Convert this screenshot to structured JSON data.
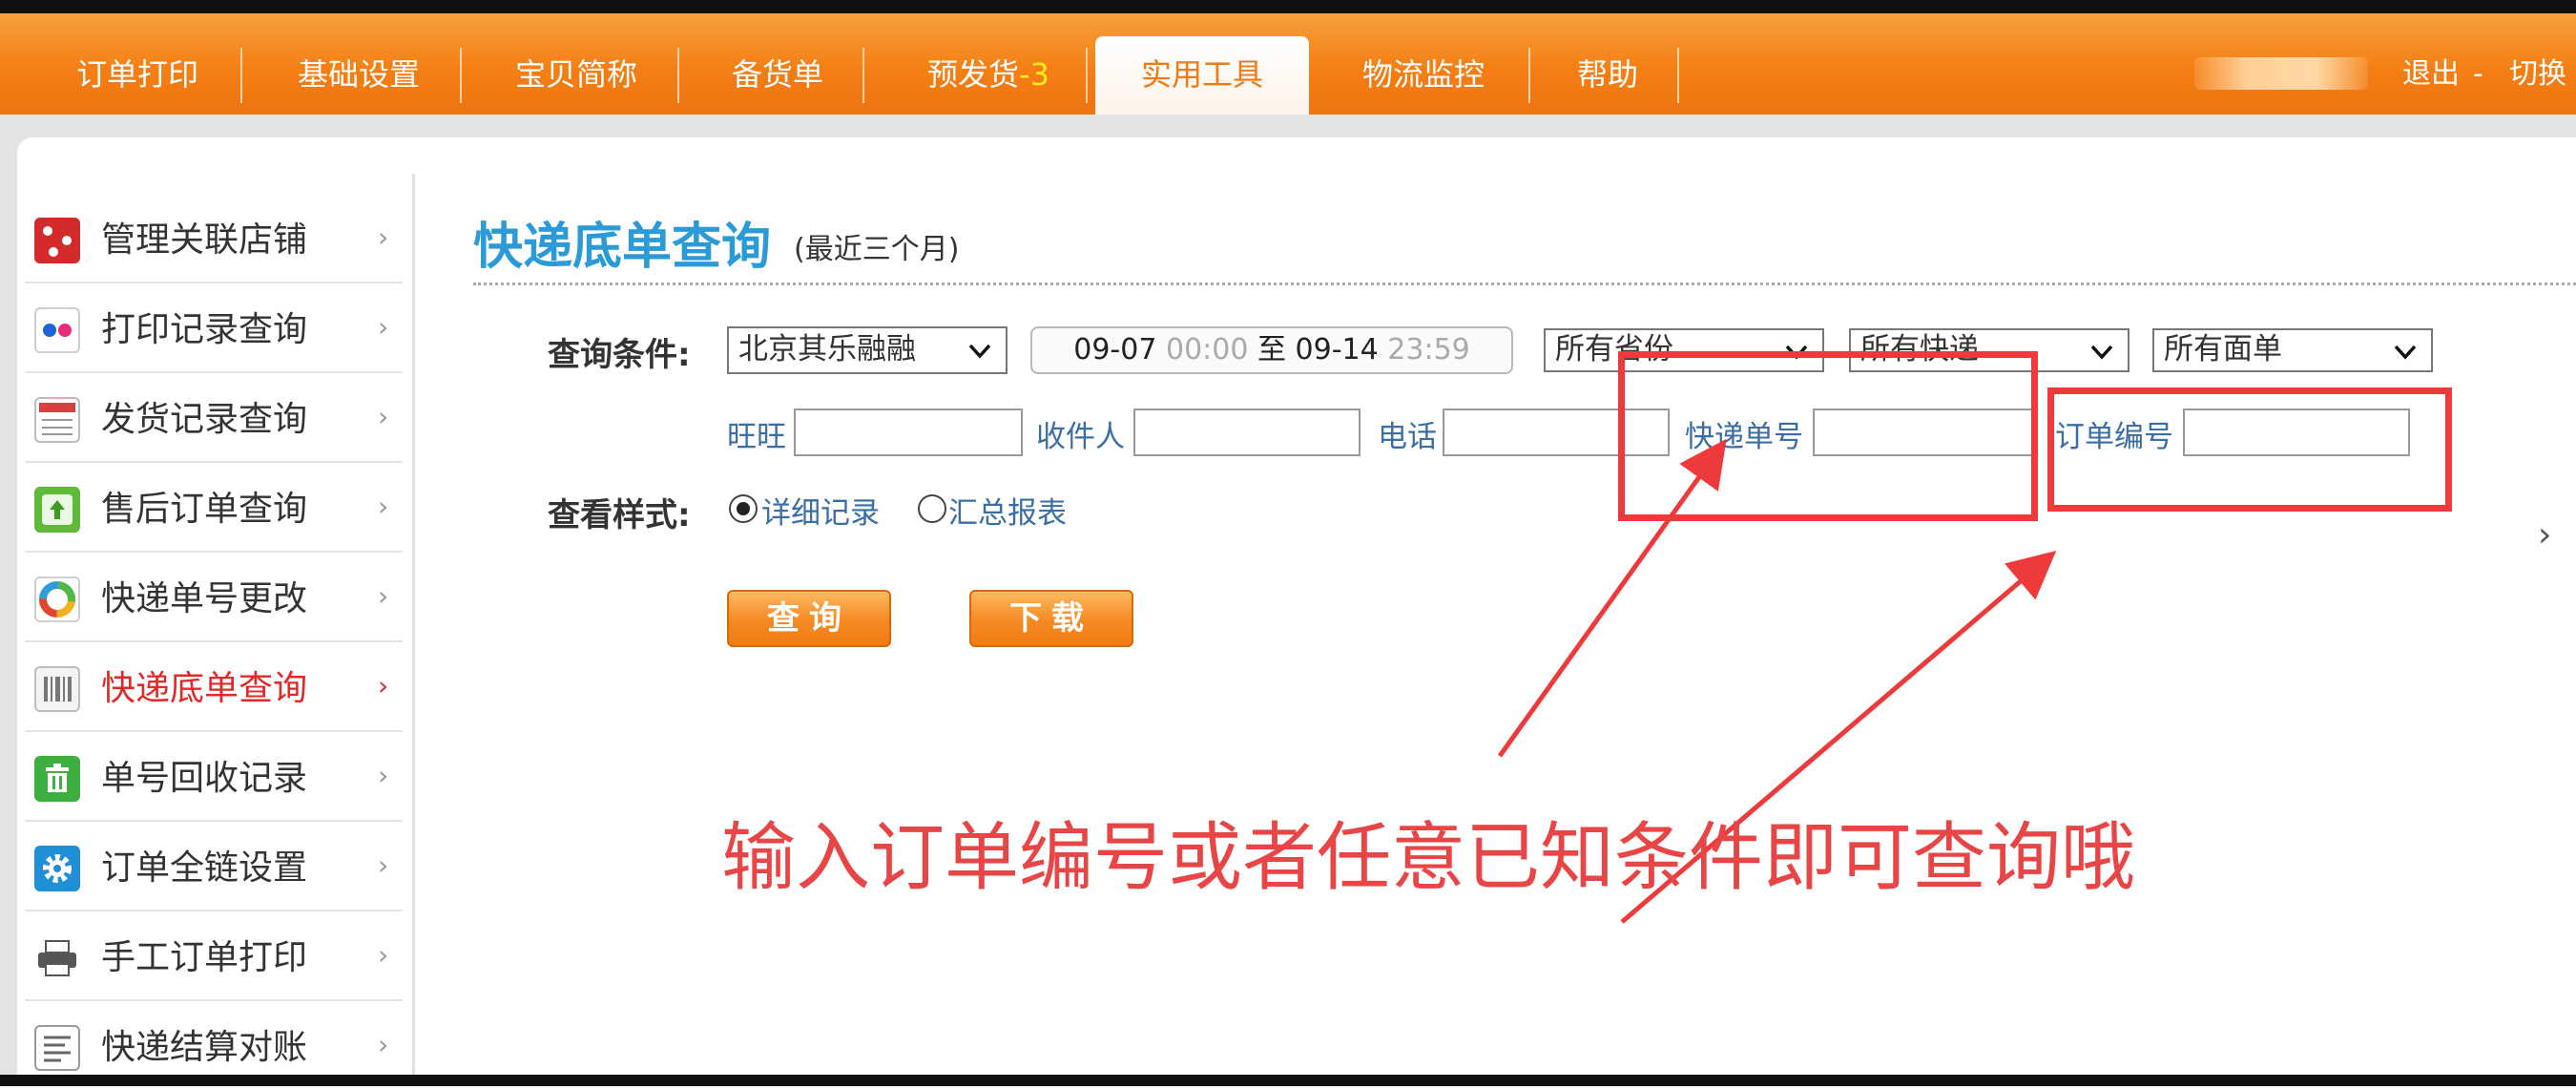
{
  "navbar": {
    "tabs": [
      {
        "label": "订单打印"
      },
      {
        "label": "基础设置"
      },
      {
        "label": "宝贝简称"
      },
      {
        "label": "备货单"
      },
      {
        "label": "预发货",
        "badge": "-3"
      },
      {
        "label": "实用工具",
        "active": true
      },
      {
        "label": "物流监控"
      },
      {
        "label": "帮助"
      }
    ],
    "logout": "退出",
    "separator": "-",
    "switch": "切换",
    "colors": {
      "bar": "#f47f14",
      "active_text": "#f07a14",
      "badge": "#ffec1f"
    }
  },
  "sidebar": {
    "items": [
      {
        "label": "管理关联店铺",
        "icon": "red-dice-icon"
      },
      {
        "label": "打印记录查询",
        "icon": "flickr-dots-icon"
      },
      {
        "label": "发货记录查询",
        "icon": "calendar-icon"
      },
      {
        "label": "售后订单查询",
        "icon": "signal-icon"
      },
      {
        "label": "快递单号更改",
        "icon": "color-wheel-icon"
      },
      {
        "label": "快递底单查询",
        "icon": "barcode-icon",
        "active": true
      },
      {
        "label": "单号回收记录",
        "icon": "trash-icon"
      },
      {
        "label": "订单全链设置",
        "icon": "gear-icon"
      },
      {
        "label": "手工订单打印",
        "icon": "printer-icon"
      },
      {
        "label": "快递结算对账",
        "icon": "document-icon"
      }
    ],
    "chevron": "›"
  },
  "page": {
    "title": "快递底单查询",
    "subtitle": "(最近三个月)"
  },
  "filters": {
    "label": "查询条件:",
    "shop": "北京其乐融融",
    "date": {
      "start_date": "09-07",
      "start_time": "00:00",
      "to": "至",
      "end_date": "09-14",
      "end_time": "23:59"
    },
    "province": "所有省份",
    "express": "所有快递",
    "waybill": "所有面单",
    "fields": {
      "wangwang": "旺旺",
      "receiver": "收件人",
      "phone": "电话",
      "tracking_no": "快递单号",
      "order_no": "订单编号"
    }
  },
  "view_style": {
    "label": "查看样式:",
    "options": [
      {
        "label": "详细记录",
        "checked": true
      },
      {
        "label": "汇总报表",
        "checked": false
      }
    ]
  },
  "buttons": {
    "query": "查询",
    "download": "下载"
  },
  "annotation": {
    "text": "输入订单编号或者任意已知条件即可查询哦",
    "color": "#e84646"
  }
}
